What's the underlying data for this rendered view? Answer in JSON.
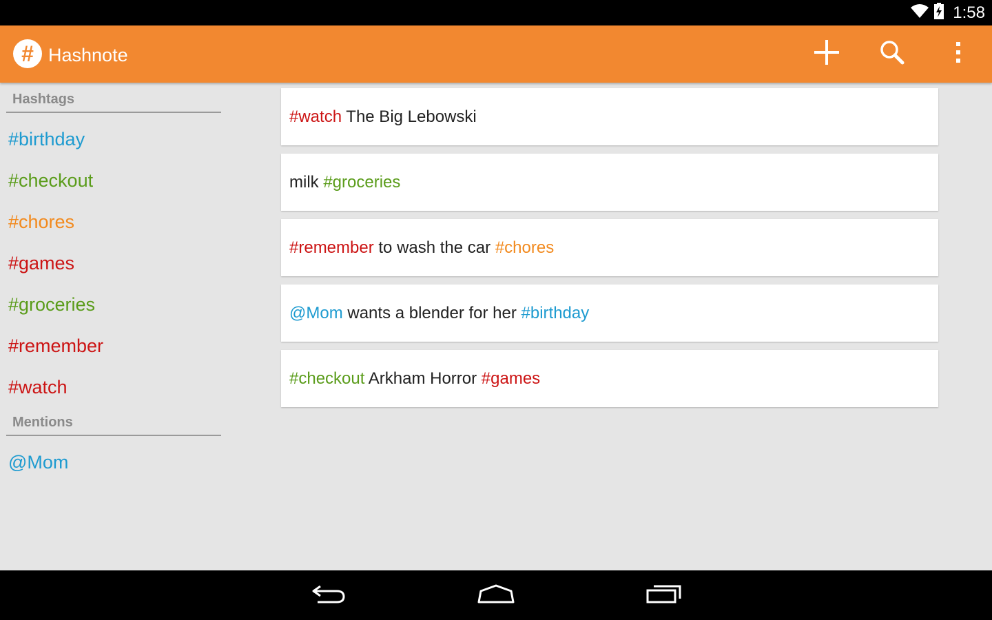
{
  "status_bar": {
    "time": "1:58",
    "icons": [
      "wifi-icon",
      "battery-charging-icon"
    ]
  },
  "action_bar": {
    "logo_symbol": "#",
    "title": "Hashnote",
    "actions": [
      "add-icon",
      "search-icon",
      "overflow-menu-icon"
    ],
    "color": "#f28830"
  },
  "sidebar": {
    "hashtags_header": "Hashtags",
    "hashtags": [
      {
        "label": "#birthday",
        "color": "#1e9bd0"
      },
      {
        "label": "#checkout",
        "color": "#5a9c1a"
      },
      {
        "label": "#chores",
        "color": "#f28a1e"
      },
      {
        "label": "#games",
        "color": "#cc1414"
      },
      {
        "label": "#groceries",
        "color": "#5a9c1a"
      },
      {
        "label": "#remember",
        "color": "#cc1414"
      },
      {
        "label": "#watch",
        "color": "#cc1414"
      }
    ],
    "mentions_header": "Mentions",
    "mentions": [
      {
        "label": "@Mom",
        "color": "#1e9bd0"
      }
    ]
  },
  "notes": [
    {
      "segments": [
        {
          "text": "#watch",
          "color": "#cc1414"
        },
        {
          "text": " The Big Lebowski",
          "color": "#222222"
        }
      ]
    },
    {
      "segments": [
        {
          "text": "milk ",
          "color": "#222222"
        },
        {
          "text": "#groceries",
          "color": "#5a9c1a"
        }
      ]
    },
    {
      "segments": [
        {
          "text": "#remember",
          "color": "#cc1414"
        },
        {
          "text": " to wash the car ",
          "color": "#222222"
        },
        {
          "text": "#chores",
          "color": "#f28a1e"
        }
      ]
    },
    {
      "segments": [
        {
          "text": "@Mom",
          "color": "#1e9bd0"
        },
        {
          "text": " wants a blender for her ",
          "color": "#222222"
        },
        {
          "text": "#birthday",
          "color": "#1e9bd0"
        }
      ]
    },
    {
      "segments": [
        {
          "text": "#checkout",
          "color": "#5a9c1a"
        },
        {
          "text": " Arkham Horror ",
          "color": "#222222"
        },
        {
          "text": "#games",
          "color": "#cc1414"
        }
      ]
    }
  ],
  "nav_bar": {
    "buttons": [
      "back-icon",
      "home-icon",
      "recent-apps-icon"
    ]
  }
}
